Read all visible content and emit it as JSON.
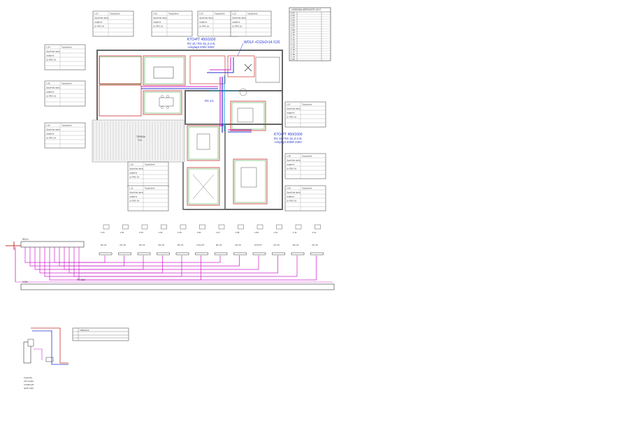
{
  "drawing": {
    "legend_title": "LEGENDA MÍSTNOSTÍ LEVÝ",
    "legend_rows": [
      "1.01",
      "1.02",
      "1.03",
      "1.04",
      "1.05",
      "1.06",
      "1.07",
      "1.08",
      "1.09",
      "1.10",
      "1.11",
      "1.12",
      "1.13",
      "1.14",
      "1.15",
      "1.16",
      "1.17",
      "1.18",
      "1.19",
      "1.20"
    ],
    "floor_notes": {
      "korpus_top": "KTO•PT 450/1600",
      "korpus_top_sub": "RV 15 / RS 15_0.3 st.",
      "korpus_top_sub2": "+elvytapt 230V 230V",
      "wolf": "WOLF •CGS•2•14 /120",
      "rs": "RS 1/1",
      "korpus_right": "KTO•PT 450/1600",
      "korpus_right_sub": "RV 15 / RS 15_0.3 st.",
      "korpus_right_sub2": "+elvytapt 400W 230V",
      "terrace": "TERASA",
      "terrace_sub": "T.01"
    },
    "room_tags": [
      {
        "id": "R1",
        "code": "1.01",
        "title": "Typ/plošné",
        "l1": "Spotřeba tepla",
        "l2": "vytápění",
        "l3": "2x PEX 16"
      },
      {
        "id": "R2",
        "code": "1.02",
        "title": "Typ/plošné",
        "l1": "Spotřeba tepla",
        "l2": "vytápění",
        "l3": "2x PEX 16"
      },
      {
        "id": "R3",
        "code": "1.03",
        "title": "Typ/plošné",
        "l1": "Spotřeba tepla",
        "l2": "vytápění",
        "l3": "2x PEX 16"
      },
      {
        "id": "R4",
        "code": "1.04",
        "title": "Typ/plošné",
        "l1": "Spotřeba tepla",
        "l2": "vytápění",
        "l3": "2x PEX 16"
      },
      {
        "id": "R5",
        "code": "1.05",
        "title": "Typ/plošné",
        "l1": "Spotřeba tepla",
        "l2": "vytápění",
        "l3": "2x PEX 16"
      },
      {
        "id": "R6",
        "code": "1.06",
        "title": "Typ/plošné",
        "l1": "Spotřeba tepla",
        "l2": "vytápění",
        "l3": "2x PEX 16"
      },
      {
        "id": "R7",
        "code": "1.07",
        "title": "Typ/plošné",
        "l1": "Spotřeba tepla",
        "l2": "vytápění",
        "l3": "2x PEX 16"
      },
      {
        "id": "R8",
        "code": "1.08",
        "title": "Typ/plošné",
        "l1": "Spotřeba tepla",
        "l2": "vytápění",
        "l3": "2x PEX 16"
      },
      {
        "id": "R9",
        "code": "1.09",
        "title": "Typ/plošné",
        "l1": "Spotřeba tepla",
        "l2": "vytápění",
        "l3": "2x PEX 16"
      },
      {
        "id": "R10",
        "code": "1.10",
        "title": "Typ/plošné",
        "l1": "Spotřeba tepla",
        "l2": "vytápění",
        "l3": "2x PEX 16"
      },
      {
        "id": "R11",
        "code": "1.11",
        "title": "Typ/plošné",
        "l1": "Spotřeba tepla",
        "l2": "vytápění",
        "l3": "2x PEX 16"
      },
      {
        "id": "R12",
        "code": "1.12",
        "title": "Typ/plošné",
        "l1": "Spotřeba tepla",
        "l2": "vytápění",
        "l3": "2x PEX 16"
      }
    ],
    "schema": {
      "manifold_label": "RS1/1",
      "circuits": [
        {
          "name": "1.01",
          "spec": "RV 15"
        },
        {
          "name": "1.02",
          "spec": "RV 15"
        },
        {
          "name": "1.03",
          "spec": "RV 15"
        },
        {
          "name": "1.04",
          "spec": "RV 15"
        },
        {
          "name": "1.05",
          "spec": "RV 15"
        },
        {
          "name": "1.06",
          "spec": "KTO-PT"
        },
        {
          "name": "1.07",
          "spec": "RV 15"
        },
        {
          "name": "1.08",
          "spec": "RV 15"
        },
        {
          "name": "1.09",
          "spec": "KTO-PT"
        },
        {
          "name": "1.10",
          "spec": "RV 15"
        },
        {
          "name": "1.11",
          "spec": "RV 15"
        },
        {
          "name": "1.12",
          "spec": "RV 15"
        }
      ],
      "trunk_label": "PE 16x2",
      "bottom_label": "0.000"
    },
    "detail": {
      "table_title": "TABULKA",
      "notes": [
        "Legenda:",
        "zdroj tepla",
        "rozdělovač",
        "teplá voda"
      ]
    }
  },
  "colors": {
    "heating_loop": "#c83030",
    "insulation": "#2e9a2e",
    "pipe_magenta": "#cc22cc",
    "pipe_blue": "#2233cc",
    "pipe_cyan": "#22aadd",
    "wall": "#666666"
  }
}
